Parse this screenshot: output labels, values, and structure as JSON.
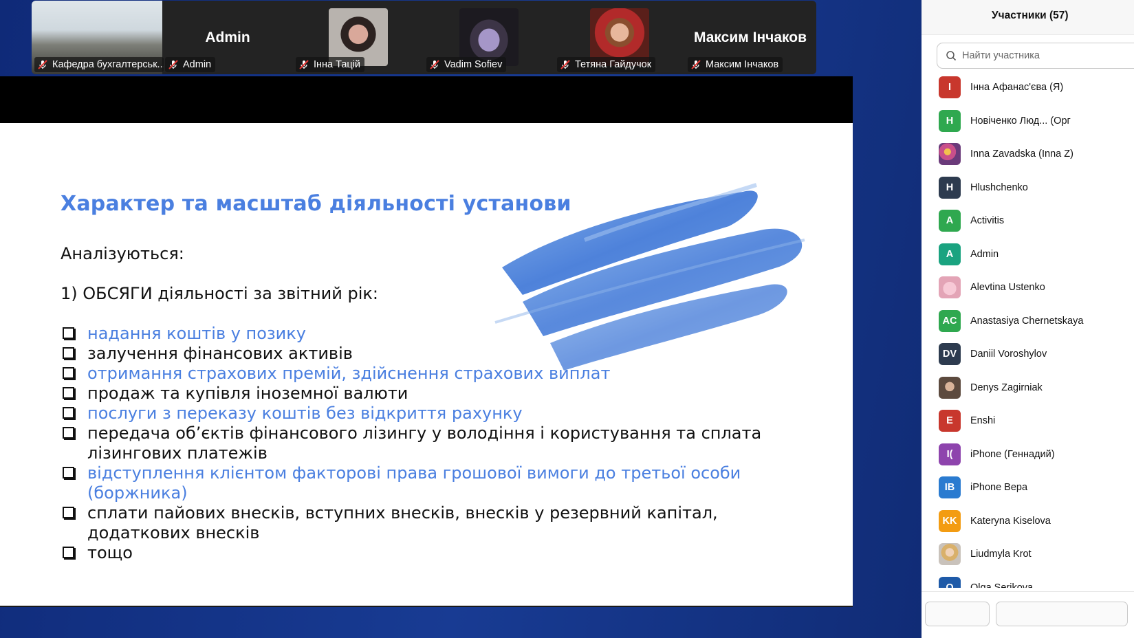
{
  "video_tiles": [
    {
      "label": "Кафедра бухгалтерськ...",
      "big_name": "",
      "pic": "classroom"
    },
    {
      "label": "Admin",
      "big_name": "Admin",
      "pic": ""
    },
    {
      "label": "Інна Тацій",
      "big_name": "",
      "pic": "person1"
    },
    {
      "label": "Vadim Sofiev",
      "big_name": "",
      "pic": "wolf"
    },
    {
      "label": "Тетяна Гайдучок",
      "big_name": "",
      "pic": "person2"
    },
    {
      "label": "Максим Інчаков",
      "big_name": "Максим Інчаков",
      "pic": ""
    }
  ],
  "slide": {
    "title": "Характер та масштаб діяльності установи",
    "analyzed": "Аналізуються:",
    "subhead": "1) ОБСЯГИ діяльності за звітний рік:",
    "items": [
      {
        "text": "надання коштів у позику",
        "blue": true
      },
      {
        "text": "залучення фінансових активів",
        "blue": false
      },
      {
        "text": "отримання страхових премій, здійснення страхових виплат",
        "blue": true
      },
      {
        "text": "продаж та купівля іноземної валюти",
        "blue": false
      },
      {
        "text": "послуги з переказу коштів без відкриття рахунку",
        "blue": true
      },
      {
        "text": "передача об’єктів фінансового лізингу у володіння і користування та сплата лізингових платежів",
        "blue": false
      },
      {
        "text": "відступлення клієнтом факторові права грошової вимоги до третьої особи (боржника)",
        "blue": true
      },
      {
        "text": "сплати пайових внесків, вступних внесків, внесків у резервний капітал, додаткових внесків",
        "blue": false
      },
      {
        "text": "тощо",
        "blue": false
      }
    ]
  },
  "participants_panel": {
    "title": "Участники (57)",
    "search_placeholder": "Найти участника",
    "participants": [
      {
        "initials": "I",
        "name": "Інна Афанас'єва (Я)",
        "color": "#c8372d"
      },
      {
        "initials": "H",
        "name": "Новіченко Люд...   (Орг",
        "color": "#2fa84f"
      },
      {
        "initials": "",
        "name": "Inna Zavadska (Inna Z)",
        "color": "#b04a7a"
      },
      {
        "initials": "H",
        "name": "Hlushchenko",
        "color": "#2d3b4f"
      },
      {
        "initials": "A",
        "name": "Activitis",
        "color": "#2fa84f"
      },
      {
        "initials": "A",
        "name": "Admin",
        "color": "#1aa380"
      },
      {
        "initials": "",
        "name": "Alevtina Ustenko",
        "color": "#e9b7c3"
      },
      {
        "initials": "AC",
        "name": "Anastasiya Chernetskaya",
        "color": "#2fa84f"
      },
      {
        "initials": "DV",
        "name": "Daniil Voroshylov",
        "color": "#2d3b4f"
      },
      {
        "initials": "",
        "name": "Denys Zagirniak",
        "color": "#8c7a66"
      },
      {
        "initials": "E",
        "name": "Enshi",
        "color": "#c8372d"
      },
      {
        "initials": "I(",
        "name": "iPhone (Геннадий)",
        "color": "#8e44ad"
      },
      {
        "initials": "IB",
        "name": "iPhone Вера",
        "color": "#2a7bd0"
      },
      {
        "initials": "KK",
        "name": "Kateryna Kiselova",
        "color": "#f39c12"
      },
      {
        "initials": "",
        "name": "Liudmyla Krot",
        "color": "#d9b28a"
      },
      {
        "initials": "O",
        "name": "Olga Serikova",
        "color": "#1e5aa8"
      }
    ]
  }
}
